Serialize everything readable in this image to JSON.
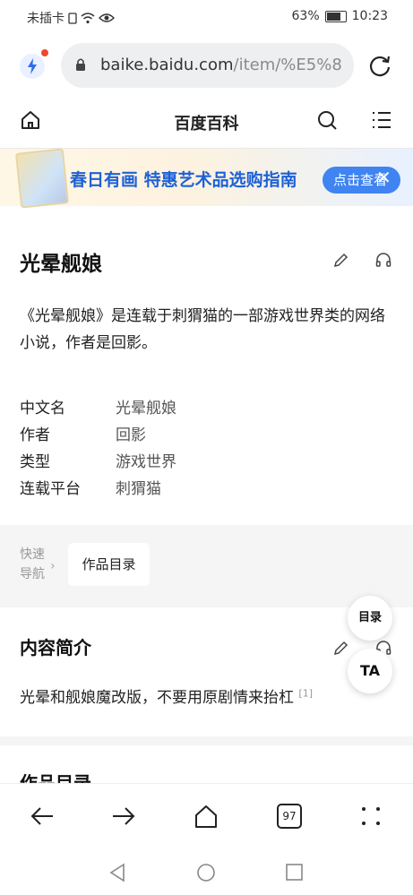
{
  "status_bar": {
    "carrier": "未插卡",
    "battery": "63%",
    "time": "10:23"
  },
  "browser": {
    "url_domain": "baike.baidu.com",
    "url_path": "/item/%E5%8"
  },
  "header": {
    "title": "百度百科"
  },
  "banner": {
    "text": "春日有画 特惠艺术品选购指南",
    "button": "点击查看"
  },
  "article": {
    "title": "光晕舰娘",
    "description": "《光晕舰娘》是连载于刺猬猫的一部游戏世界类的网络小说，作者是回影。",
    "info": [
      {
        "key": "中文名",
        "value": "光晕舰娘"
      },
      {
        "key": "作者",
        "value": "回影"
      },
      {
        "key": "类型",
        "value": "游戏世界"
      },
      {
        "key": "连载平台",
        "value": "刺猬猫"
      }
    ]
  },
  "quick_nav": {
    "label_line1": "快速",
    "label_line2": "导航",
    "item": "作品目录"
  },
  "summary_section": {
    "title": "内容简介",
    "text": "光晕和舰娘魔改版，不要用原剧情来抬杠",
    "ref": "[1]"
  },
  "next_section": {
    "title": "作品目录"
  },
  "floating": {
    "toc": "目录",
    "ta": "TA"
  },
  "toolbar": {
    "tab_count": "97"
  },
  "colors": {
    "accent": "#3f84f0",
    "banner_text": "#1e61d6"
  }
}
